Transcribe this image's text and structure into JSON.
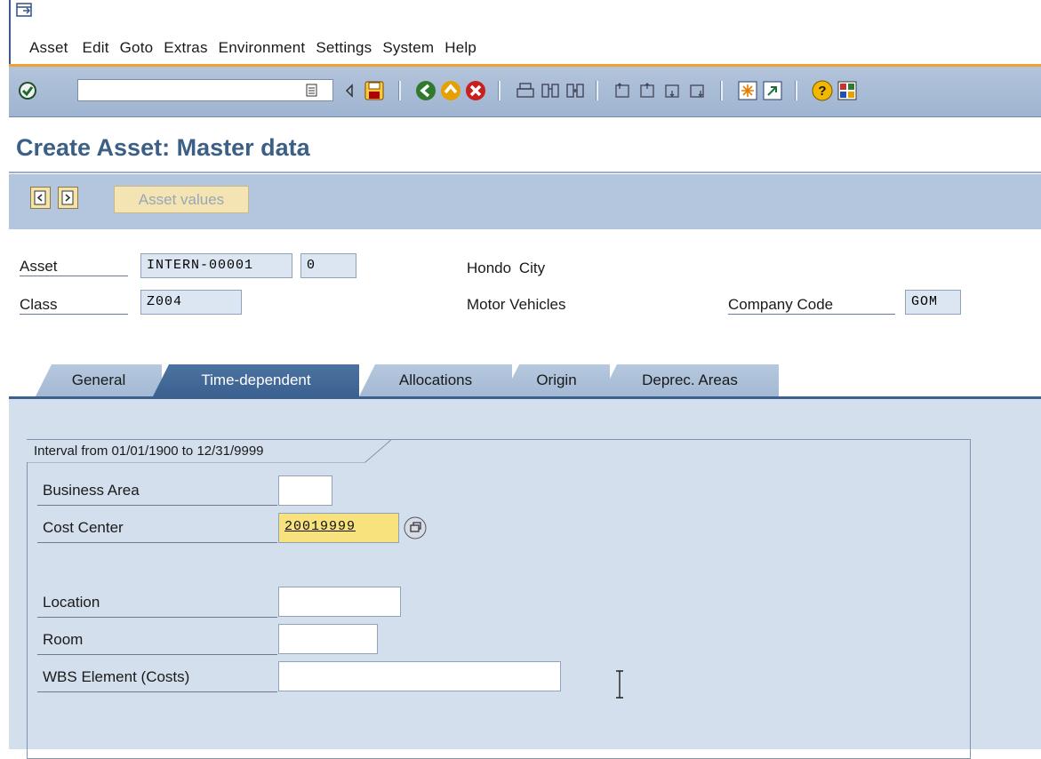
{
  "menu": {
    "items": [
      "Asset",
      "Edit",
      "Goto",
      "Extras",
      "Environment",
      "Settings",
      "System",
      "Help"
    ]
  },
  "toolbar": {
    "command_field_value": "",
    "icons": [
      "enter-icon",
      "command-history-icon",
      "back-arrow-icon",
      "save-icon",
      "back-icon",
      "exit-icon",
      "cancel-icon",
      "print-icon",
      "find-icon",
      "find-next-icon",
      "first-page-icon",
      "previous-page-icon",
      "next-page-icon",
      "last-page-icon",
      "create-session-icon",
      "shortcut-icon",
      "help-icon",
      "layout-menu-icon"
    ]
  },
  "page": {
    "title": "Create Asset: Master data"
  },
  "app_toolbar": {
    "asset_values_label": "Asset values"
  },
  "header": {
    "asset_label": "Asset",
    "asset_number": "INTERN-00001",
    "asset_subnumber": "0",
    "asset_description": "Hondo  City",
    "class_label": "Class",
    "class_value": "Z004",
    "class_description": "Motor Vehicles",
    "company_code_label": "Company Code",
    "company_code_value": "GOM"
  },
  "tabs": [
    {
      "label": "General",
      "active": false
    },
    {
      "label": "Time-dependent",
      "active": true
    },
    {
      "label": "Allocations",
      "active": false
    },
    {
      "label": "Origin",
      "active": false
    },
    {
      "label": "Deprec. Areas",
      "active": false
    }
  ],
  "time_dependent": {
    "interval_title": "Interval from 01/01/1900 to 12/31/9999",
    "business_area_label": "Business Area",
    "business_area_value": "",
    "cost_center_label": "Cost Center",
    "cost_center_value": "20019999",
    "location_label": "Location",
    "location_value": "",
    "room_label": "Room",
    "room_value": "",
    "wbs_label": "WBS Element (Costs)",
    "wbs_value": ""
  },
  "colors": {
    "title": "#3c5f86",
    "active_tab": "#3a6190",
    "toolbar": "#a9bdd7",
    "content_bg": "#d3dfed",
    "required_field": "#f7e27e",
    "menu_accent": "#f0a030"
  }
}
